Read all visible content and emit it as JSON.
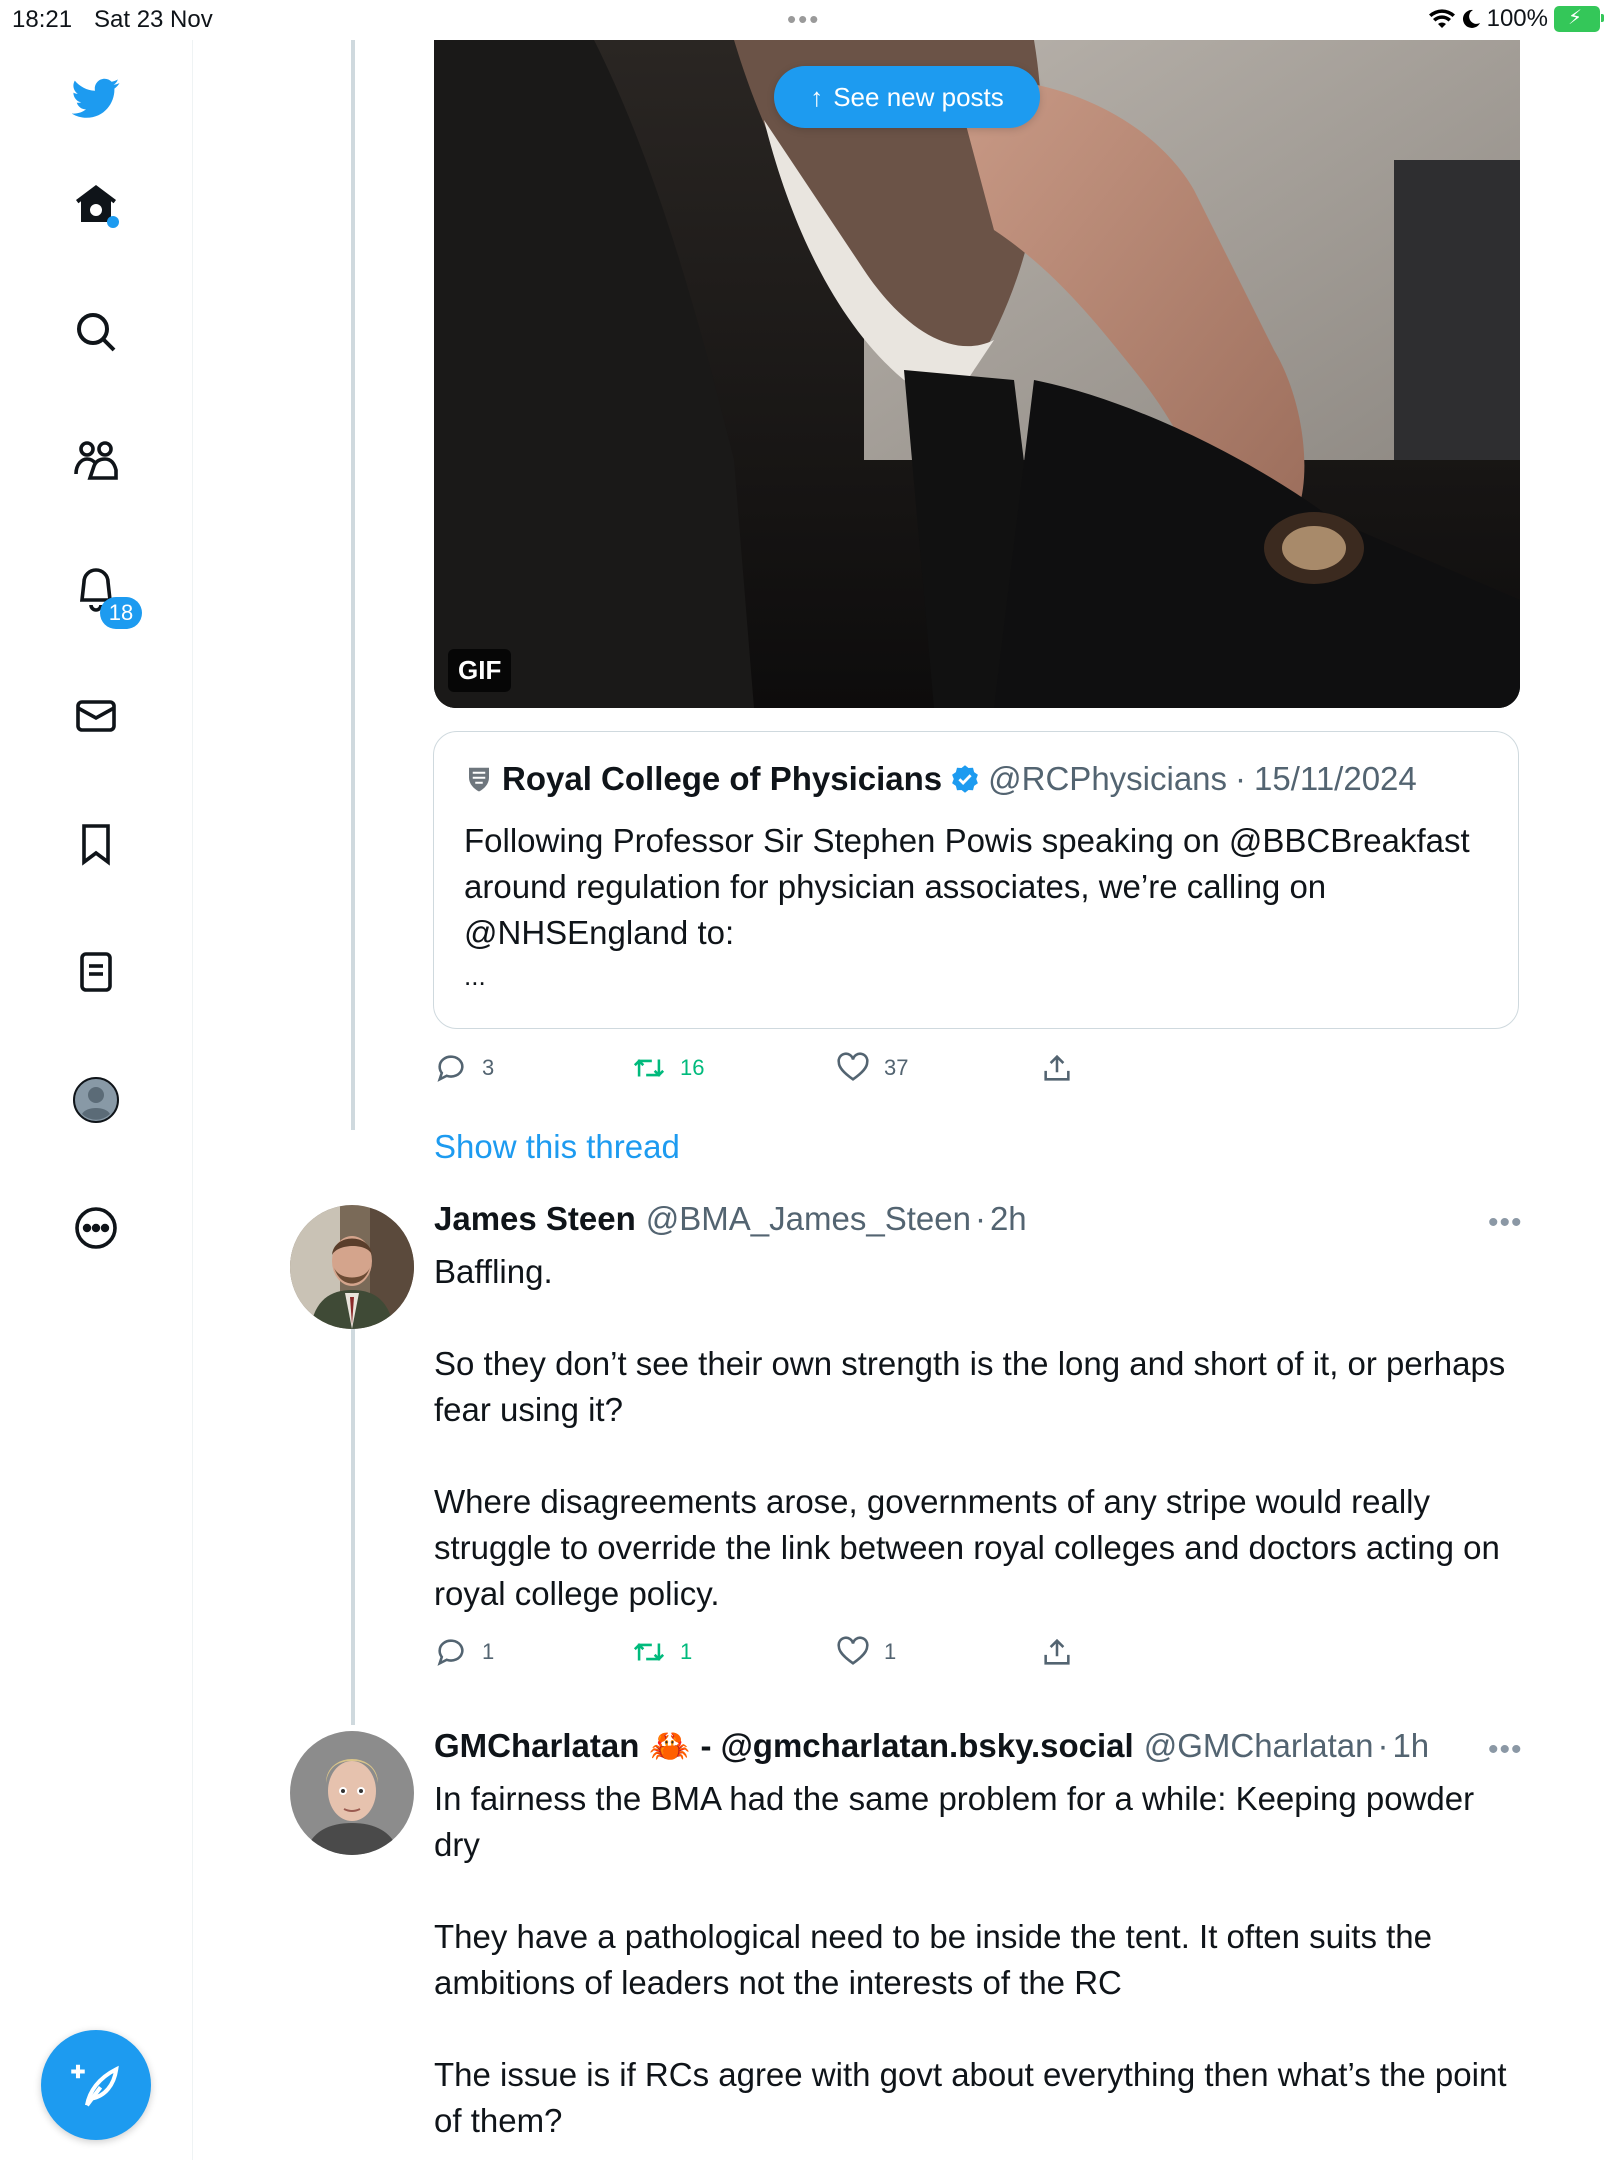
{
  "status_bar": {
    "time": "18:21",
    "date": "Sat 23 Nov",
    "battery": "100%"
  },
  "sidebar": {
    "notifications_badge": "18"
  },
  "banner": {
    "see_new_posts": "See new posts"
  },
  "media": {
    "gif_label": "GIF"
  },
  "quote": {
    "name": "Royal College of Physicians",
    "handle": "@RCPhysicians",
    "date": "15/11/2024",
    "text": "Following Professor Sir Stephen Powis speaking on @BBCBreakfast around regulation for physician associates, we’re calling on @NHSEngland to:",
    "ellipsis": "..."
  },
  "tweet1_actions": {
    "replies": "3",
    "retweets": "16",
    "likes": "37"
  },
  "show_thread": "Show this thread",
  "tweet2": {
    "name": "James Steen",
    "handle": "@BMA_James_Steen",
    "time": "2h",
    "p1": "Baffling.",
    "p2": "So they don’t see their own strength is the long and short of it, or perhaps fear using it?",
    "p3": "Where disagreements arose, governments of any stripe would really struggle to override the link between royal colleges and doctors acting on royal college policy.",
    "replies": "1",
    "retweets": "1",
    "likes": "1"
  },
  "tweet3": {
    "name": "GMCharlatan",
    "crab": "🦀",
    "name_suffix": "- @gmcharlatan.bsky.social",
    "handle": "@GMCharlatan",
    "time": "1h",
    "p1": "In fairness the BMA had the same problem for a while: Keeping powder dry",
    "p2": "They have a pathological need to be inside the tent. It often suits the ambitions of leaders not the interests of the RC",
    "p3": "The issue is if RCs agree with govt about everything then what’s the point of them?"
  },
  "colors": {
    "accent": "#1d9bf0",
    "retweet_green": "#00ba7c",
    "secondary_text": "#536471"
  }
}
